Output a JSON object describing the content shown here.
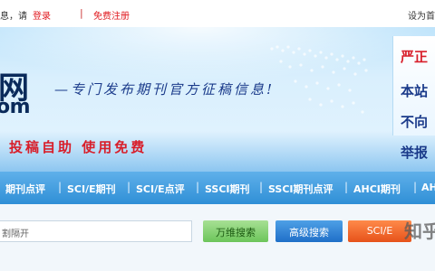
{
  "topbar": {
    "greeting": "息，请",
    "login_label": "登录",
    "separator": "|",
    "register_label": "免费注册",
    "right_text": "设为首"
  },
  "banner": {
    "brand_char": "网",
    "brand_sub": "om",
    "slogan": "—专门发布期刊官方征稿信息!",
    "tagline": "投稿自助  使用免费",
    "side_lines": [
      {
        "text": "严正",
        "color": "#d81e2a"
      },
      {
        "text": "本站",
        "color": "#1a3a8a"
      },
      {
        "text": "不向",
        "color": "#1a3a8a"
      },
      {
        "text": "举报",
        "color": "#1a3a8a"
      }
    ]
  },
  "nav": {
    "items": [
      "期刊点评",
      "SCI/E期刊",
      "SCI/E点评",
      "SSCI期刊",
      "SSCI期刊点评",
      "AHCI期刊",
      "AH"
    ],
    "separator": "|"
  },
  "search": {
    "placeholder": "割隔开",
    "buttons": {
      "wanwei": "万维搜索",
      "advanced": "高级搜索",
      "scie": "SCI/E"
    }
  },
  "watermark": "知乎",
  "colors": {
    "nav_blue": "#2f8fd6",
    "accent_red": "#d81e2a",
    "slogan_blue": "#1a3a8a"
  }
}
